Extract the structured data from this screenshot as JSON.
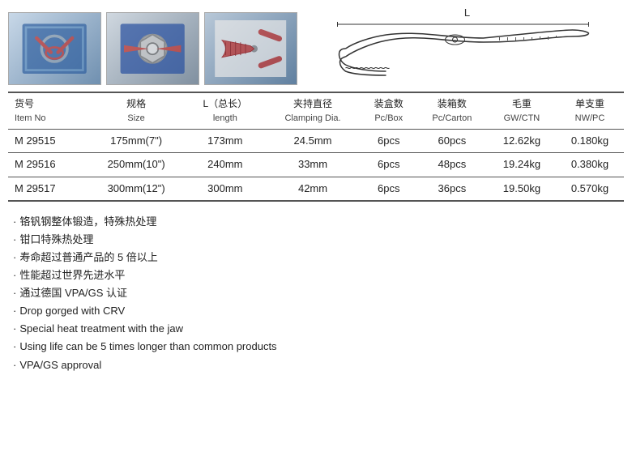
{
  "images": {
    "photos": [
      {
        "id": "photo1",
        "alt": "Product photo 1"
      },
      {
        "id": "photo2",
        "alt": "Product photo 2"
      },
      {
        "id": "photo3",
        "alt": "Product photo 3"
      }
    ],
    "line_drawing_label": "L"
  },
  "table": {
    "headers": [
      {
        "cn": "货号",
        "en": "Item No"
      },
      {
        "cn": "规格",
        "en": "Size"
      },
      {
        "cn": "L（总长）",
        "en": "length"
      },
      {
        "cn": "夹持直径",
        "en": "Clamping Dia."
      },
      {
        "cn": "装盒数",
        "en": "Pc/Box"
      },
      {
        "cn": "装箱数",
        "en": "Pc/Carton"
      },
      {
        "cn": "毛重",
        "en": "GW/CTN"
      },
      {
        "cn": "单支重",
        "en": "NW/PC"
      }
    ],
    "rows": [
      {
        "item_no": "M 29515",
        "size": "175mm(7\")",
        "length": "173mm",
        "clamping": "24.5mm",
        "pc_box": "6pcs",
        "pc_carton": "60pcs",
        "gw": "12.62kg",
        "nw": "0.180kg"
      },
      {
        "item_no": "M 29516",
        "size": "250mm(10\")",
        "length": "240mm",
        "clamping": "33mm",
        "pc_box": "6pcs",
        "pc_carton": "48pcs",
        "gw": "19.24kg",
        "nw": "0.380kg"
      },
      {
        "item_no": "M 29517",
        "size": "300mm(12\")",
        "length": "300mm",
        "clamping": "42mm",
        "pc_box": "6pcs",
        "pc_carton": "36pcs",
        "gw": "19.50kg",
        "nw": "0.570kg"
      }
    ]
  },
  "features": [
    "铬钒钢整体锻造，特殊热处理",
    "钳口特殊热处理",
    "寿命超过普通产品的 5 倍以上",
    "性能超过世界先进水平",
    "通过德国 VPA/GS 认证",
    "Drop gorged with CRV",
    "Special heat treatment with the jaw",
    "Using life can be 5 times longer than common products",
    "VPA/GS approval"
  ]
}
